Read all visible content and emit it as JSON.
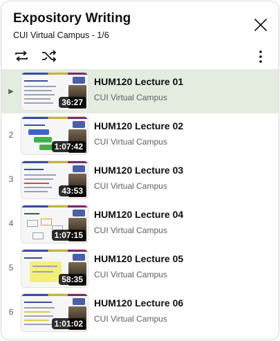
{
  "playlist": {
    "title": "Expository Writing",
    "owner": "CUI Virtual Campus",
    "position": "1/6",
    "subtitle": "CUI Virtual Campus - 1/6"
  },
  "controls": {
    "close_icon": "close-icon",
    "loop_icon": "loop-icon",
    "shuffle_icon": "shuffle-icon",
    "more_icon": "more-vert-icon"
  },
  "colors": {
    "active_row_bg": "#e4ebdf",
    "duration_badge_bg": "#000000",
    "channel_text": "#606060"
  },
  "videos": [
    {
      "index": "▶",
      "title": "HUM120 Lecture 01",
      "channel": "CUI Virtual Campus",
      "duration": "36:27",
      "active": true
    },
    {
      "index": "2",
      "title": "HUM120 Lecture 02",
      "channel": "CUI Virtual Campus",
      "duration": "1:07:42",
      "active": false
    },
    {
      "index": "3",
      "title": "HUM120 Lecture 03",
      "channel": "CUI Virtual Campus",
      "duration": "43:53",
      "active": false
    },
    {
      "index": "4",
      "title": "HUM120 Lecture 04",
      "channel": "CUI Virtual Campus",
      "duration": "1:07:15",
      "active": false
    },
    {
      "index": "5",
      "title": "HUM120 Lecture 05",
      "channel": "CUI Virtual Campus",
      "duration": "58:35",
      "active": false
    },
    {
      "index": "6",
      "title": "HUM120 Lecture 06",
      "channel": "CUI Virtual Campus",
      "duration": "1:01:02",
      "active": false
    }
  ]
}
